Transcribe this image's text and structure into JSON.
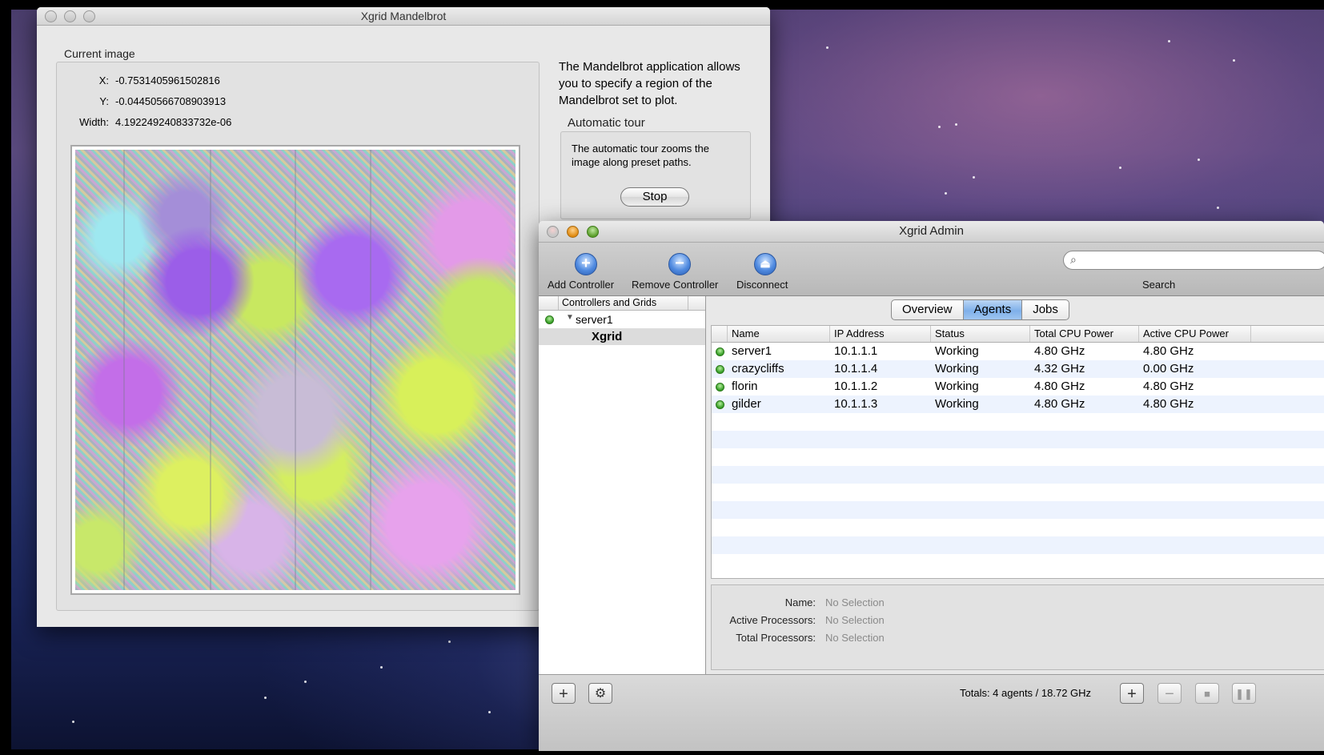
{
  "mandelbrot_window": {
    "title": "Xgrid Mandelbrot",
    "current_image_title": "Current image",
    "x_label": "X:",
    "x_value": "-0.7531405961502816",
    "y_label": "Y:",
    "y_value": "-0.04450566708903913",
    "width_label": "Width:",
    "width_value": "4.192249240833732e-06",
    "description": "The Mandelbrot application allows you to specify a region of the Mandelbrot set to plot.",
    "tour_title": "Automatic tour",
    "tour_description": "The automatic tour zooms the image along preset paths.",
    "stop_label": "Stop"
  },
  "admin_window": {
    "title": "Xgrid Admin",
    "toolbar": {
      "add_controller": "Add Controller",
      "remove_controller": "Remove Controller",
      "disconnect": "Disconnect",
      "search_label": "Search",
      "search_value": ""
    },
    "sidebar": {
      "header": "Controllers and Grids",
      "server": "server1",
      "grid": "Xgrid"
    },
    "tabs": [
      "Overview",
      "Agents",
      "Jobs"
    ],
    "active_tab": "Agents",
    "table": {
      "columns": [
        "Name",
        "IP Address",
        "Status",
        "Total CPU Power",
        "Active CPU Power"
      ],
      "rows": [
        {
          "name": "server1",
          "ip": "10.1.1.1",
          "status": "Working",
          "total": "4.80 GHz",
          "active": "4.80 GHz"
        },
        {
          "name": "crazycliffs",
          "ip": "10.1.1.4",
          "status": "Working",
          "total": "4.32 GHz",
          "active": "0.00 GHz"
        },
        {
          "name": "florin",
          "ip": "10.1.1.2",
          "status": "Working",
          "total": "4.80 GHz",
          "active": "4.80 GHz"
        },
        {
          "name": "gilder",
          "ip": "10.1.1.3",
          "status": "Working",
          "total": "4.80 GHz",
          "active": "4.80 GHz"
        }
      ]
    },
    "details": {
      "name_label": "Name:",
      "name_value": "No Selection",
      "active_label": "Active Processors:",
      "active_value": "No Selection",
      "total_label": "Total Processors:",
      "total_value": "No Selection"
    },
    "bottom": {
      "totals": "Totals: 4 agents / 18.72 GHz"
    }
  },
  "colors": {
    "selection_blue": "#7fb0ea",
    "row_alt": "#edf3fe",
    "status_green": "#3aa02a"
  }
}
